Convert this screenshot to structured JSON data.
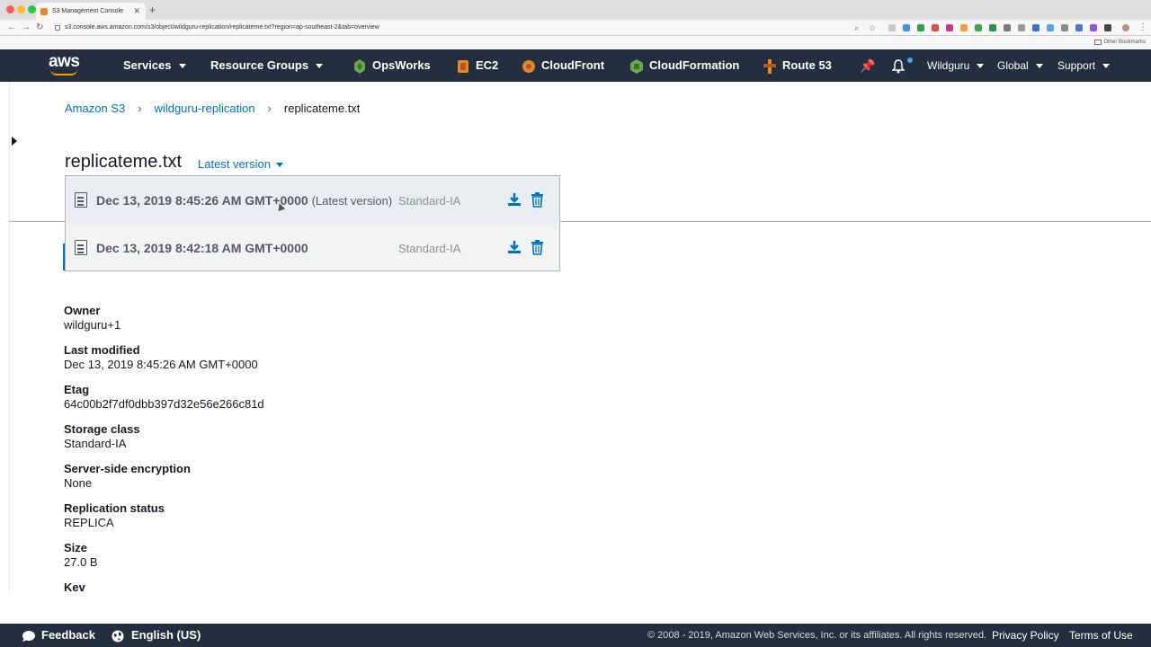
{
  "browser": {
    "tab_title": "S3 Management Console",
    "url": "s3.console.aws.amazon.com/s3/object/wildguru-replication/replicateme.txt?region=ap-southeast-2&tab=overview",
    "other_bookmarks": "Other Bookmarks"
  },
  "nav": {
    "logo": "aws",
    "services": "Services",
    "resource_groups": "Resource Groups",
    "shortcuts": [
      "OpsWorks",
      "EC2",
      "CloudFront",
      "CloudFormation",
      "Route 53"
    ],
    "account": "Wildguru",
    "region": "Global",
    "support": "Support"
  },
  "breadcrumb": [
    "Amazon S3",
    "wildguru-replication",
    "replicateme.txt"
  ],
  "page": {
    "title": "replicateme.txt",
    "version_selector": "Latest version"
  },
  "versions": [
    {
      "date": "Dec 13, 2019 8:45:26 AM GMT+0000",
      "tag": "(Latest version)",
      "storage_class": "Standard-IA"
    },
    {
      "date": "Dec 13, 2019 8:42:18 AM GMT+0000",
      "tag": "",
      "storage_class": "Standard-IA"
    }
  ],
  "properties": [
    {
      "label": "Owner",
      "value": "wildguru+1"
    },
    {
      "label": "Last modified",
      "value": "Dec 13, 2019 8:45:26 AM GMT+0000"
    },
    {
      "label": "Etag",
      "value": "64c00b2f7df0dbb397d32e56e266c81d"
    },
    {
      "label": "Storage class",
      "value": "Standard-IA"
    },
    {
      "label": "Server-side encryption",
      "value": "None"
    },
    {
      "label": "Replication status",
      "value": "REPLICA"
    },
    {
      "label": "Size",
      "value": "27.0 B"
    },
    {
      "label": "Kev",
      "value": ""
    }
  ],
  "footer": {
    "feedback": "Feedback",
    "language": "English (US)",
    "copyright": "© 2008 - 2019, Amazon Web Services, Inc. or its affiliates. All rights reserved.",
    "privacy": "Privacy Policy",
    "terms": "Terms of Use"
  },
  "colors": {
    "nav_bg": "#232f3e",
    "link": "#0073bb",
    "accent": "#ff9900"
  },
  "icons": [
    "sidebar-toggle-icon",
    "document-icon",
    "download-icon",
    "trash-icon",
    "pin-icon",
    "bell-icon",
    "chat-icon",
    "globe-icon"
  ]
}
